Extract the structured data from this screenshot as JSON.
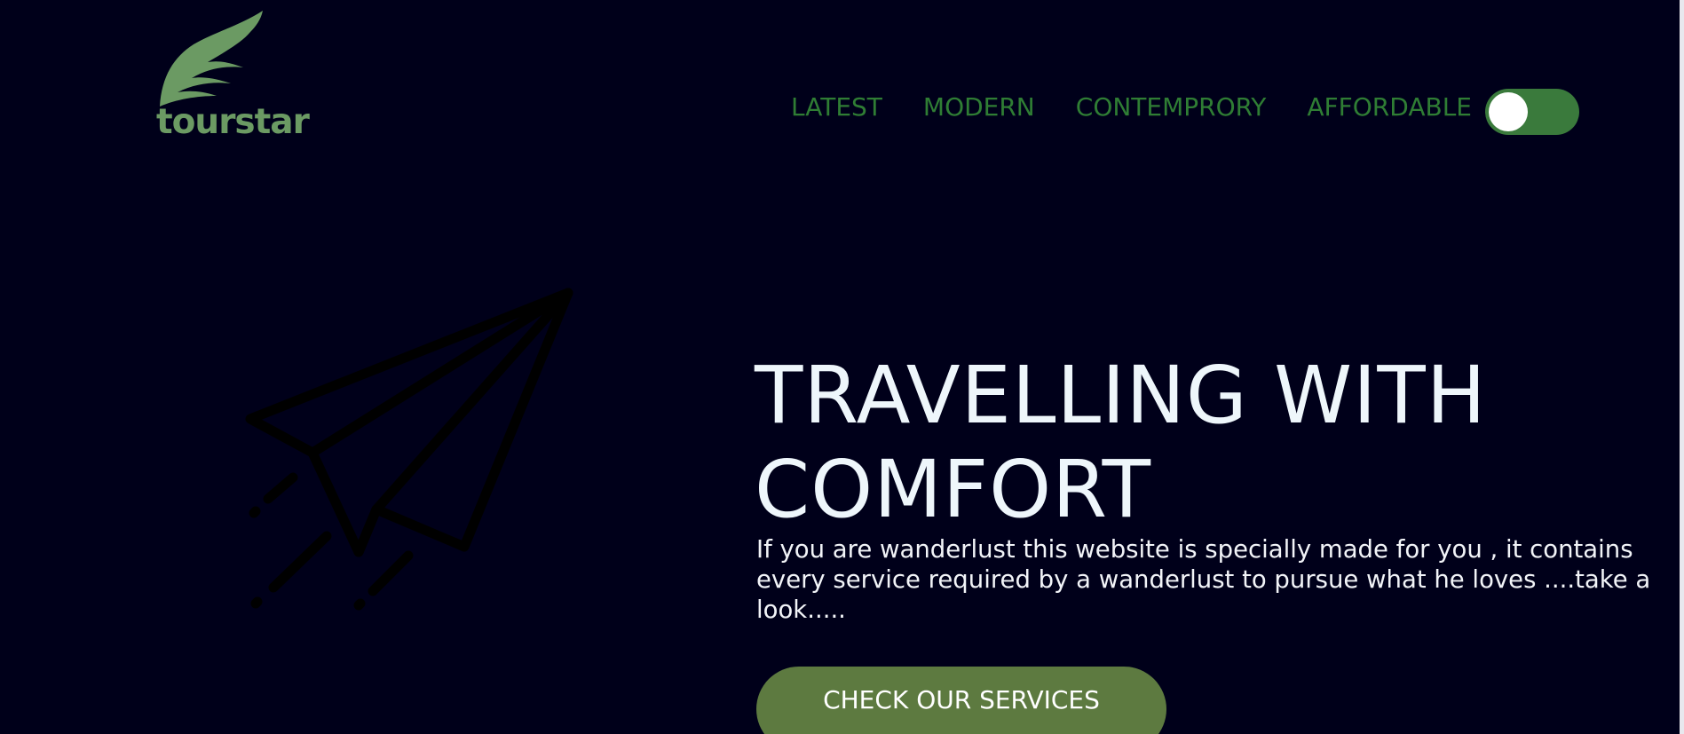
{
  "header": {
    "logo_text": "tourstar",
    "nav": [
      {
        "label": "LATEST"
      },
      {
        "label": "MODERN"
      },
      {
        "label": "CONTEMPRORY"
      },
      {
        "label": "AFFORDABLE"
      }
    ],
    "theme_toggle": {
      "on": true
    }
  },
  "hero": {
    "title_line1": "TRAVELLING WITH",
    "title_line2": "COMFORT",
    "description": "If you are wanderlust this website is specially made for you , it contains every service required by a wanderlust to pursue what he loves ....take a look.....",
    "cta_label": "CHECK OUR SERVICES",
    "illustration_icon": "paper-plane-icon"
  },
  "colors": {
    "background": "#00001a",
    "nav_text": "#2f7d34",
    "logo": "#6b9a63",
    "toggle": "#3a7a3c",
    "cta": "#5d7a40",
    "hero_text": "#eef6fb"
  }
}
